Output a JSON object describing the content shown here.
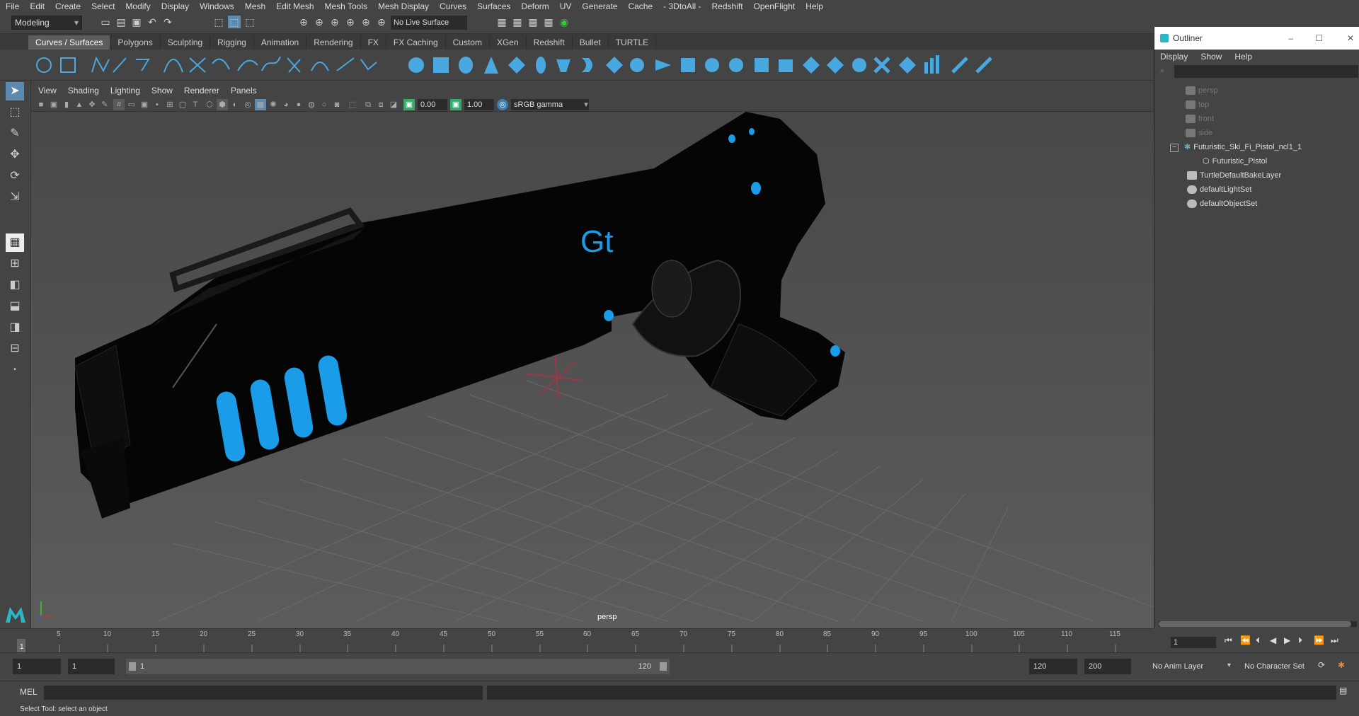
{
  "menubar": [
    "File",
    "Edit",
    "Create",
    "Select",
    "Modify",
    "Display",
    "Windows",
    "Mesh",
    "Edit Mesh",
    "Mesh Tools",
    "Mesh Display",
    "Curves",
    "Surfaces",
    "Deform",
    "UV",
    "Generate",
    "Cache",
    "- 3DtoAll -",
    "Redshift",
    "OpenFlight",
    "Help"
  ],
  "status": {
    "mode": "Modeling",
    "live_surface": "No Live Surface"
  },
  "shelf_tabs": [
    "Curves / Surfaces",
    "Polygons",
    "Sculpting",
    "Rigging",
    "Animation",
    "Rendering",
    "FX",
    "FX Caching",
    "Custom",
    "XGen",
    "Redshift",
    "Bullet",
    "TURTLE"
  ],
  "panel_menu": [
    "View",
    "Shading",
    "Lighting",
    "Show",
    "Renderer",
    "Panels"
  ],
  "panel_toolbar": {
    "exposure": "0.00",
    "gamma": "1.00",
    "colorspace": "sRGB gamma"
  },
  "viewport": {
    "camera": "persp",
    "logo_text": "Gt"
  },
  "outliner": {
    "title": "Outliner",
    "menu": [
      "Display",
      "Show",
      "Help"
    ],
    "items": [
      "persp",
      "top",
      "front",
      "side",
      "Futuristic_Ski_Fi_Pistol_ncl1_1",
      "Futuristic_Pistol",
      "TurtleDefaultBakeLayer",
      "defaultLightSet",
      "defaultObjectSet"
    ]
  },
  "timeline": {
    "ticks": [
      "1",
      "5",
      "10",
      "15",
      "20",
      "25",
      "30",
      "35",
      "40",
      "45",
      "50",
      "55",
      "60",
      "65",
      "70",
      "75",
      "80",
      "85",
      "90",
      "95",
      "100",
      "105",
      "110",
      "115"
    ],
    "current_frame": "1"
  },
  "range": {
    "start": "1",
    "start2": "1",
    "range_start": "1",
    "range_end": "120",
    "end": "120",
    "end2": "200",
    "anim_layer": "No Anim Layer",
    "char_set": "No Character Set"
  },
  "cmd": {
    "label": "MEL"
  },
  "help": "Select Tool: select an object",
  "colors": {
    "accent": "#1ea0f0",
    "panel": "#444444",
    "dark": "#2b2b2b"
  }
}
